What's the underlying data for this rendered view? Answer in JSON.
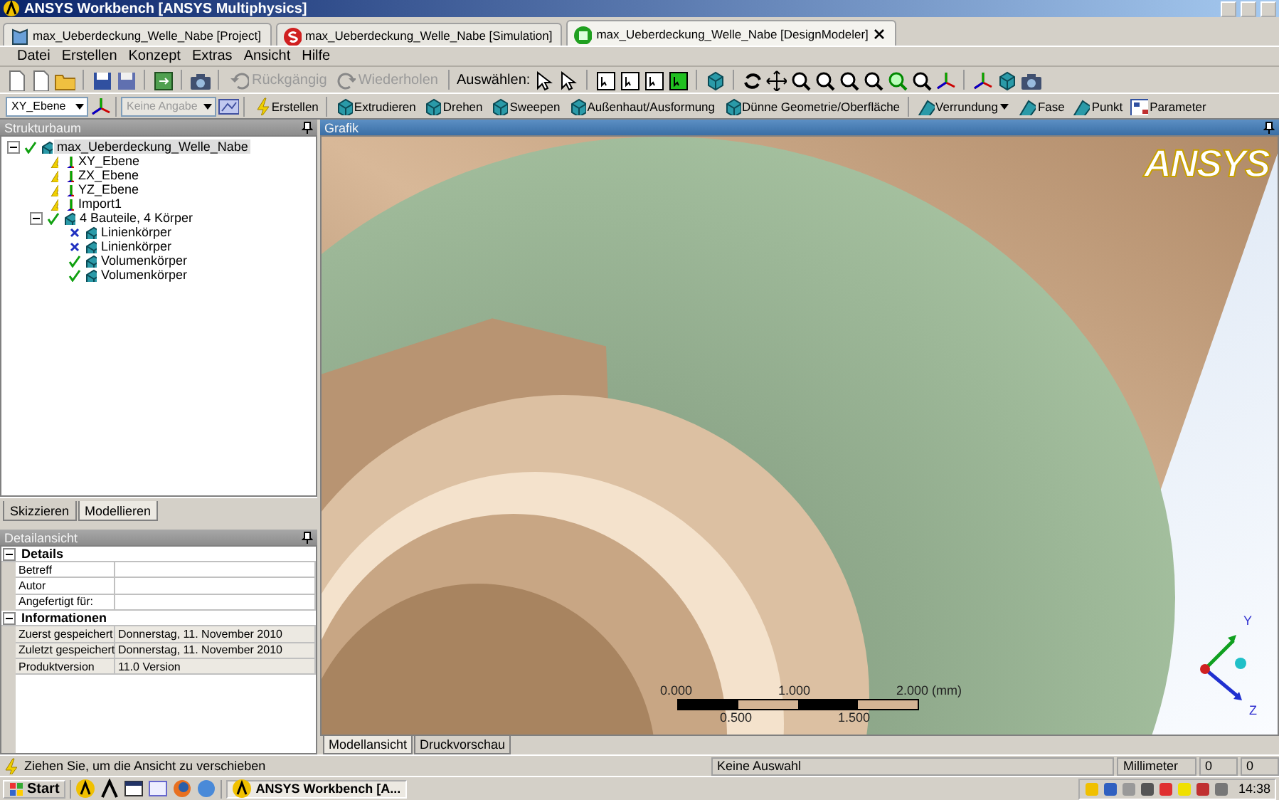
{
  "window": {
    "title": "ANSYS Workbench [ANSYS Multiphysics]"
  },
  "doc_tabs": [
    {
      "label": "max_Ueberdeckung_Welle_Nabe [Project]",
      "kind": "project",
      "selected": false
    },
    {
      "label": "max_Ueberdeckung_Welle_Nabe [Simulation]",
      "kind": "simulation",
      "selected": false
    },
    {
      "label": "max_Ueberdeckung_Welle_Nabe [DesignModeler]",
      "kind": "designmodeler",
      "selected": true
    }
  ],
  "menu": [
    "Datei",
    "Erstellen",
    "Konzept",
    "Extras",
    "Ansicht",
    "Hilfe"
  ],
  "toolbar_main": {
    "undo": {
      "label": "Rückgängig",
      "disabled": true
    },
    "redo": {
      "label": "Wiederholen",
      "disabled": true
    },
    "select_label": "Auswählen:"
  },
  "toolbar_model": {
    "plane": {
      "value": "XY_Ebene"
    },
    "sketch": {
      "value": "Keine Angabe",
      "disabled": true
    },
    "buttons": [
      {
        "label": "Erstellen",
        "dropdown": false
      },
      {
        "label": "Extrudieren",
        "dropdown": false
      },
      {
        "label": "Drehen",
        "dropdown": false
      },
      {
        "label": "Sweepen",
        "dropdown": false
      },
      {
        "label": "Außenhaut/Ausformung",
        "dropdown": false
      },
      {
        "label": "Dünne Geometrie/Oberfläche",
        "dropdown": false
      },
      {
        "label": "Verrundung",
        "dropdown": true
      },
      {
        "label": "Fase",
        "dropdown": false
      },
      {
        "label": "Punkt",
        "dropdown": false
      },
      {
        "label": "Parameter",
        "dropdown": false
      }
    ]
  },
  "tree": {
    "title": "Strukturbaum",
    "nodes": [
      {
        "label": "max_Ueberdeckung_Welle_Nabe",
        "kind": "check",
        "selected": true,
        "expanded": true,
        "children": [
          {
            "label": "XY_Ebene",
            "kind": "lightning",
            "selected": false
          },
          {
            "label": "ZX_Ebene",
            "kind": "lightning",
            "selected": false
          },
          {
            "label": "YZ_Ebene",
            "kind": "lightning",
            "selected": false
          },
          {
            "label": "Import1",
            "kind": "lightning",
            "selected": false
          },
          {
            "label": "4 Bauteile, 4 Körper",
            "kind": "check",
            "selected": false,
            "expanded": true,
            "children": [
              {
                "label": "Linienkörper",
                "kind": "x",
                "selected": false
              },
              {
                "label": "Linienkörper",
                "kind": "x",
                "selected": false
              },
              {
                "label": "Volumenkörper",
                "kind": "check",
                "selected": false
              },
              {
                "label": "Volumenkörper",
                "kind": "check",
                "selected": false
              }
            ]
          }
        ]
      }
    ]
  },
  "panel_tabs": [
    {
      "label": "Skizzieren",
      "selected": false
    },
    {
      "label": "Modellieren",
      "selected": true
    }
  ],
  "details": {
    "title": "Detailansicht",
    "groups": [
      {
        "title": "Details",
        "expanded": true,
        "rows": [
          {
            "label": "Betreff"
          },
          {
            "label": "Autor"
          },
          {
            "label": "Angefertigt für:"
          }
        ]
      },
      {
        "title": "Informationen",
        "expanded": true,
        "rows": [
          {
            "label": "Zuerst gespeichert",
            "value": "Donnerstag, 11. November 2010"
          },
          {
            "label": "Zuletzt gespeichert",
            "value": "Donnerstag, 11. November 2010"
          },
          {
            "label": "Produktversion",
            "value": "11.0  Version"
          }
        ]
      }
    ]
  },
  "graphics": {
    "title": "Grafik",
    "logo": "ANSYS",
    "scale_bar": {
      "top_labels": [
        "0.000",
        "1.000",
        "2.000 (mm)"
      ],
      "bottom_labels": [
        "0.500",
        "1.500"
      ]
    },
    "axes": [
      "Y",
      "Z"
    ],
    "view_tabs": [
      {
        "label": "Modellansicht",
        "selected": true
      },
      {
        "label": "Druckvorschau",
        "selected": false
      }
    ]
  },
  "status_bar": {
    "message": "Ziehen Sie, um die Ansicht zu verschieben",
    "selection": "Keine Auswahl",
    "unit": "Millimeter",
    "coordinate_1": "0",
    "coordinate_2": "0"
  },
  "taskbar": {
    "start": "Start",
    "tasks": [
      {
        "label": "ANSYS Workbench [A...",
        "selected": true
      }
    ],
    "clock": "14:38"
  }
}
